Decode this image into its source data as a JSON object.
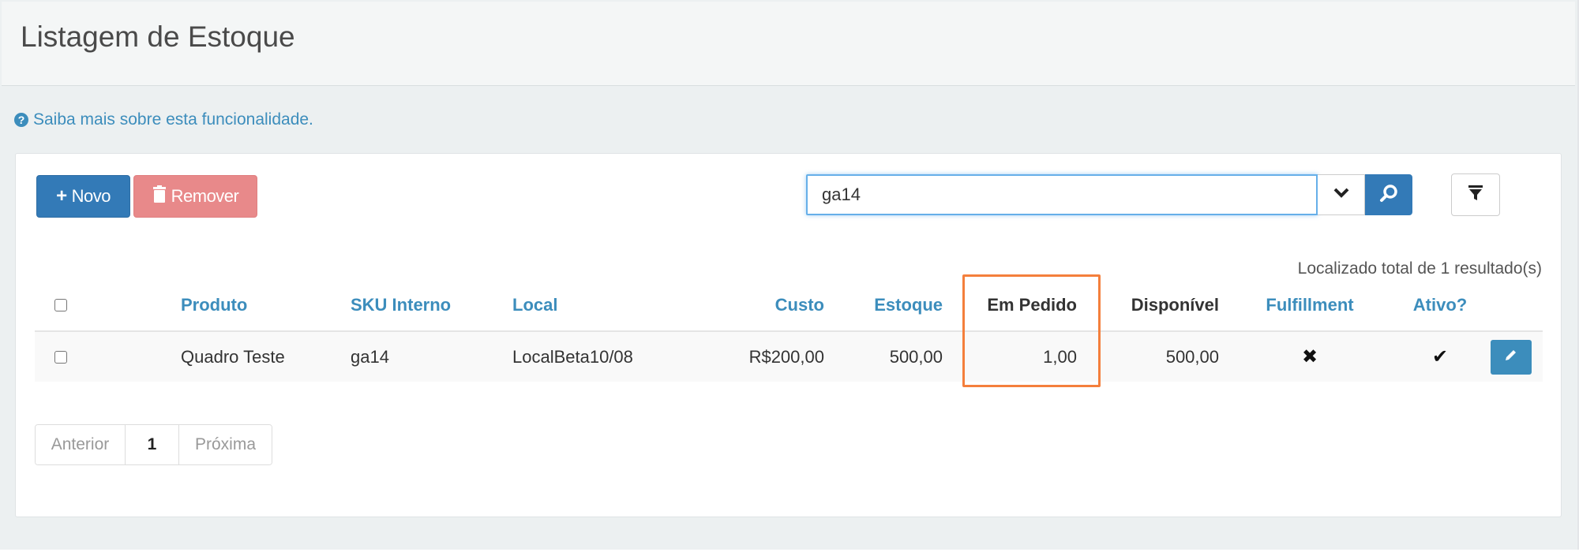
{
  "page": {
    "title": "Listagem de Estoque",
    "help_link": "Saiba mais sobre esta funcionalidade."
  },
  "toolbar": {
    "new_label": "Novo",
    "remove_label": "Remover",
    "search_value": "ga14"
  },
  "results": {
    "count_text": "Localizado total de 1 resultado(s)"
  },
  "table": {
    "headers": {
      "produto": "Produto",
      "sku": "SKU Interno",
      "local": "Local",
      "custo": "Custo",
      "estoque": "Estoque",
      "em_pedido": "Em Pedido",
      "disponivel": "Disponível",
      "fulfillment": "Fulfillment",
      "ativo": "Ativo?"
    },
    "rows": [
      {
        "produto": "Quadro Teste",
        "sku": "ga14",
        "local": "LocalBeta10/08",
        "custo": "R$200,00",
        "estoque": "500,00",
        "em_pedido": "1,00",
        "disponivel": "500,00",
        "fulfillment": "✖",
        "ativo": "✔"
      }
    ]
  },
  "pagination": {
    "prev": "Anterior",
    "current": "1",
    "next": "Próxima"
  },
  "colors": {
    "primary": "#337ab7",
    "danger": "#e8898a",
    "link": "#3c8dbc",
    "highlight": "#f47f3c"
  },
  "icons": {
    "help": "question-circle-icon",
    "add": "plus-icon",
    "remove": "trash-icon",
    "dropdown": "chevron-down-icon",
    "search": "search-icon",
    "filter": "filter-icon",
    "edit": "pencil-icon"
  }
}
